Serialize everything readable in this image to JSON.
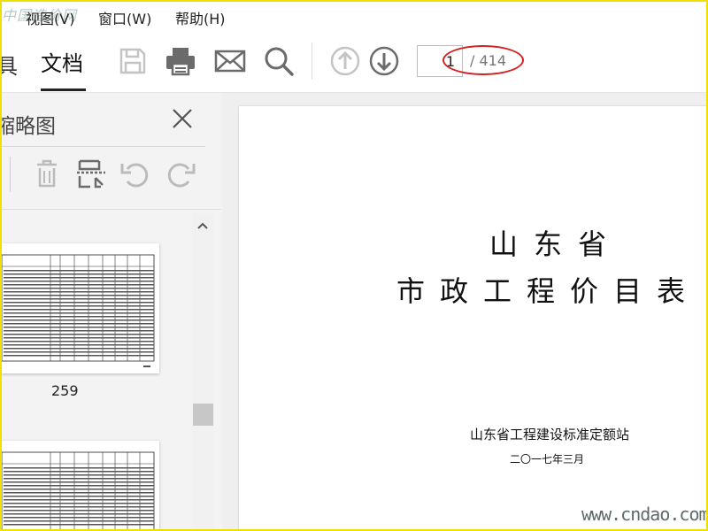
{
  "watermark_top": "中国造价网",
  "watermark_bottom": "www.cndao.com",
  "menu": [
    "视图(V)",
    "窗口(W)",
    "帮助(H)"
  ],
  "toolbar": {
    "tab_partial": "具",
    "tab_doc": "文档",
    "icons": [
      "save-icon",
      "print-icon",
      "mail-icon",
      "search-icon",
      "page-up-icon",
      "page-down-icon"
    ],
    "page_current": "1",
    "page_total": "/ 414"
  },
  "sidebar": {
    "title": "缩略图",
    "close": "×",
    "icons": [
      "delete-icon",
      "extract-icon",
      "rotate-left-icon",
      "rotate-right-icon"
    ],
    "thumbnail_label": "259"
  },
  "document": {
    "title_line1": "山东省",
    "title_line2": "市政工程价目表",
    "org": "山东省工程建设标准定额站",
    "date": "二〇一七年三月"
  },
  "colors": {
    "highlight": "#d42020",
    "border": "#f0e000"
  }
}
